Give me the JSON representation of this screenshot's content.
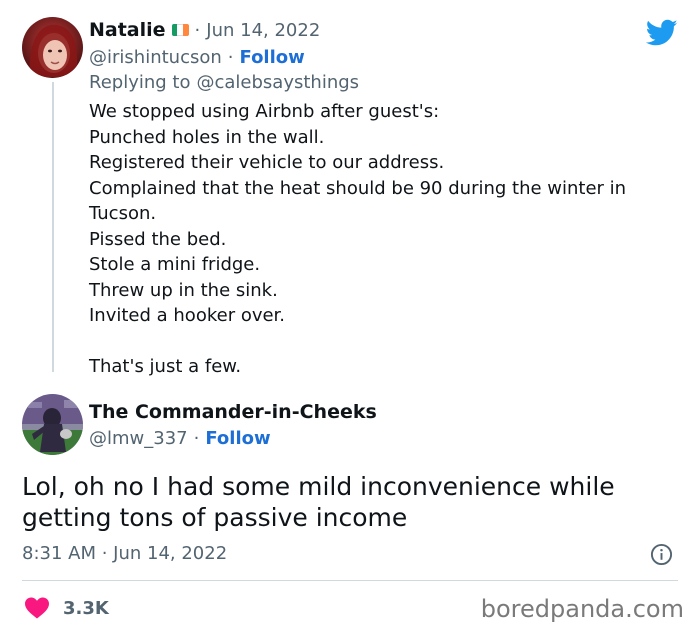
{
  "reply_tweet": {
    "author_name": "Natalie",
    "flag": "ireland-flag",
    "date_sep": "·",
    "date": "Jun 14, 2022",
    "handle": "@irishintucson",
    "handle_sep": "·",
    "follow_label": "Follow",
    "replying_prefix": "Replying to",
    "replying_to": "@calebsaysthings",
    "lines": [
      "We stopped using Airbnb after guest's:",
      "Punched holes in the wall.",
      "Registered their vehicle to our address.",
      "Complained that the heat should be 90 during the winter in",
      "Tucson.",
      "Pissed the bed.",
      "Stole a mini fridge.",
      "Threw up in the sink.",
      "Invited a hooker over.",
      "",
      "That's just a few."
    ]
  },
  "main_tweet": {
    "author_name": "The Commander-in-Cheeks",
    "handle": "@lmw_337",
    "handle_sep": "·",
    "follow_label": "Follow",
    "text": "Lol, oh no I had some mild inconvenience while getting tons of passive income",
    "time": "8:31 AM · Jun 14, 2022",
    "likes": "3.3K"
  },
  "icons": {
    "platform": "twitter-bird-icon",
    "info": "info-icon",
    "like": "heart-icon"
  },
  "watermark": "boredpanda.com",
  "colors": {
    "accent": "#1d9bf0",
    "follow": "#1d6fd6",
    "like": "#f91880",
    "muted": "#536471"
  }
}
